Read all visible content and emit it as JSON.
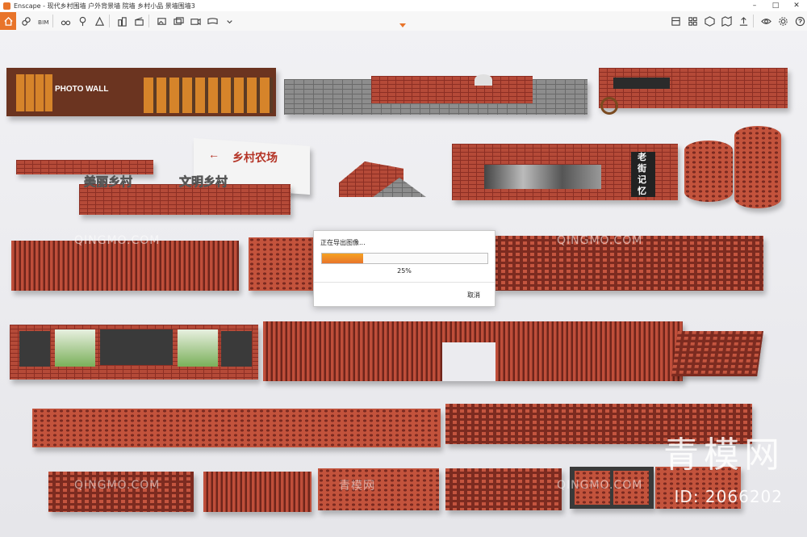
{
  "window": {
    "title": "Enscape - 现代乡村围墙 户外背景墙 院墙 乡村小品 景墙围墙3",
    "minimize": "–",
    "maximize": "□",
    "close": "✕"
  },
  "dialog": {
    "title": "正在导出图像...",
    "progress_label": "25%",
    "progress_value": 0.25,
    "cancel_label": "取消"
  },
  "scene": {
    "photo_wall_label": "PHOTO WALL",
    "sign_farm": "乡村农场",
    "sign_arrow": "←",
    "sign_beautiful": "美丽乡村",
    "sign_civilized": "文明乡村",
    "sign_street_a": "老",
    "sign_street_b": "街",
    "sign_street_c": "记",
    "sign_street_d": "忆",
    "watermark_brand": "QINGMO.COM",
    "watermark_cn": "青模网",
    "big_watermark": "青模网",
    "id_label": "ID: 2066202"
  },
  "colors": {
    "accent": "#e8742a",
    "brick": "#b54a38",
    "progress": "#f0901e"
  }
}
